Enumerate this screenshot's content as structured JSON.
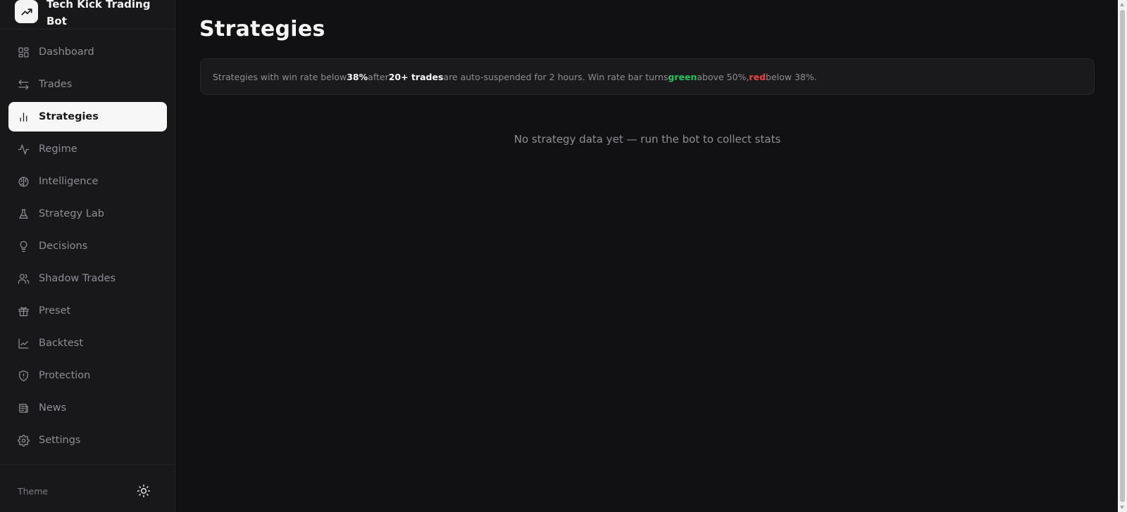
{
  "brand": {
    "name": "Tech Kick Trading Bot",
    "icon": "trending-up-icon"
  },
  "sidebar": {
    "items": [
      {
        "label": "Dashboard",
        "icon": "dashboard-icon",
        "active": false
      },
      {
        "label": "Trades",
        "icon": "arrows-swap-icon",
        "active": false
      },
      {
        "label": "Strategies",
        "icon": "bar-chart-icon",
        "active": true
      },
      {
        "label": "Regime",
        "icon": "activity-icon",
        "active": false
      },
      {
        "label": "Intelligence",
        "icon": "brain-icon",
        "active": false
      },
      {
        "label": "Strategy Lab",
        "icon": "flask-icon",
        "active": false
      },
      {
        "label": "Decisions",
        "icon": "lightbulb-icon",
        "active": false
      },
      {
        "label": "Shadow Trades",
        "icon": "users-icon",
        "active": false
      },
      {
        "label": "Preset",
        "icon": "gift-icon",
        "active": false
      },
      {
        "label": "Backtest",
        "icon": "line-chart-icon",
        "active": false
      },
      {
        "label": "Protection",
        "icon": "shield-icon",
        "active": false
      },
      {
        "label": "News",
        "icon": "newspaper-icon",
        "active": false
      },
      {
        "label": "Settings",
        "icon": "gear-icon",
        "active": false
      }
    ],
    "footer": {
      "theme_label": "Theme",
      "theme_icon": "sun-icon"
    }
  },
  "main": {
    "title": "Strategies",
    "info": {
      "part1": "Strategies with win rate below ",
      "threshold": "38%",
      "part2": " after ",
      "trades": "20+ trades",
      "part3": " are auto-suspended for 2 hours. Win rate bar turns ",
      "green_word": "green",
      "part4": " above 50%, ",
      "red_word": "red",
      "part5": " below 38%."
    },
    "empty_message": "No strategy data yet — run the bot to collect stats"
  },
  "colors": {
    "background": "#111114",
    "sidebar": "#18181b",
    "active_item": "#f7f7f8",
    "green": "#22c55e",
    "red": "#ef4444"
  }
}
